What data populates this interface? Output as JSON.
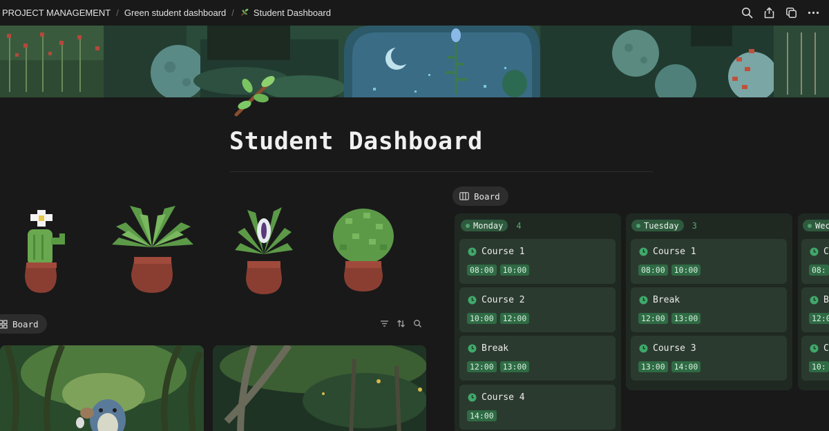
{
  "breadcrumb": {
    "items": [
      {
        "label": "PROJECT MANAGEMENT"
      },
      {
        "label": "Green student dashboard"
      },
      {
        "label": "Student Dashboard",
        "icon": "leaf-icon"
      }
    ],
    "separator": "/"
  },
  "top_actions": [
    "search-icon",
    "share-icon",
    "duplicate-icon",
    "more-icon"
  ],
  "page": {
    "icon": "leaf-branch-icon",
    "title": "Student Dashboard"
  },
  "plants": [
    "cactus-plant",
    "fern-plant",
    "flower-plant",
    "bush-plant"
  ],
  "left_view": {
    "label": "Board",
    "tools": [
      "filter-icon",
      "sort-icon",
      "search-icon"
    ]
  },
  "right_view": {
    "label": "Board"
  },
  "board": {
    "columns": [
      {
        "name": "Monday",
        "count": "4",
        "cards": [
          {
            "title": "Course 1",
            "times": [
              "08:00",
              "10:00"
            ]
          },
          {
            "title": "Course 2",
            "times": [
              "10:00",
              "12:00"
            ]
          },
          {
            "title": "Break",
            "times": [
              "12:00",
              "13:00"
            ]
          },
          {
            "title": "Course 4",
            "times": [
              "14:00"
            ]
          }
        ]
      },
      {
        "name": "Tuesday",
        "count": "3",
        "cards": [
          {
            "title": "Course 1",
            "times": [
              "08:00",
              "10:00"
            ]
          },
          {
            "title": "Break",
            "times": [
              "12:00",
              "13:00"
            ]
          },
          {
            "title": "Course 3",
            "times": [
              "13:00",
              "14:00"
            ]
          }
        ]
      },
      {
        "name": "Wec",
        "cards": [
          {
            "title": "C",
            "times": [
              "08:"
            ]
          },
          {
            "title": "B",
            "times": [
              "12:0"
            ]
          },
          {
            "title": "C",
            "times": [
              "10:"
            ]
          }
        ]
      }
    ]
  },
  "colors": {
    "background": "#191919",
    "column": "#1f2922",
    "card": "#2b3a2f",
    "tag": "#2f6b44",
    "pill": "#2e5a3d",
    "accent_green": "#58a86f"
  }
}
